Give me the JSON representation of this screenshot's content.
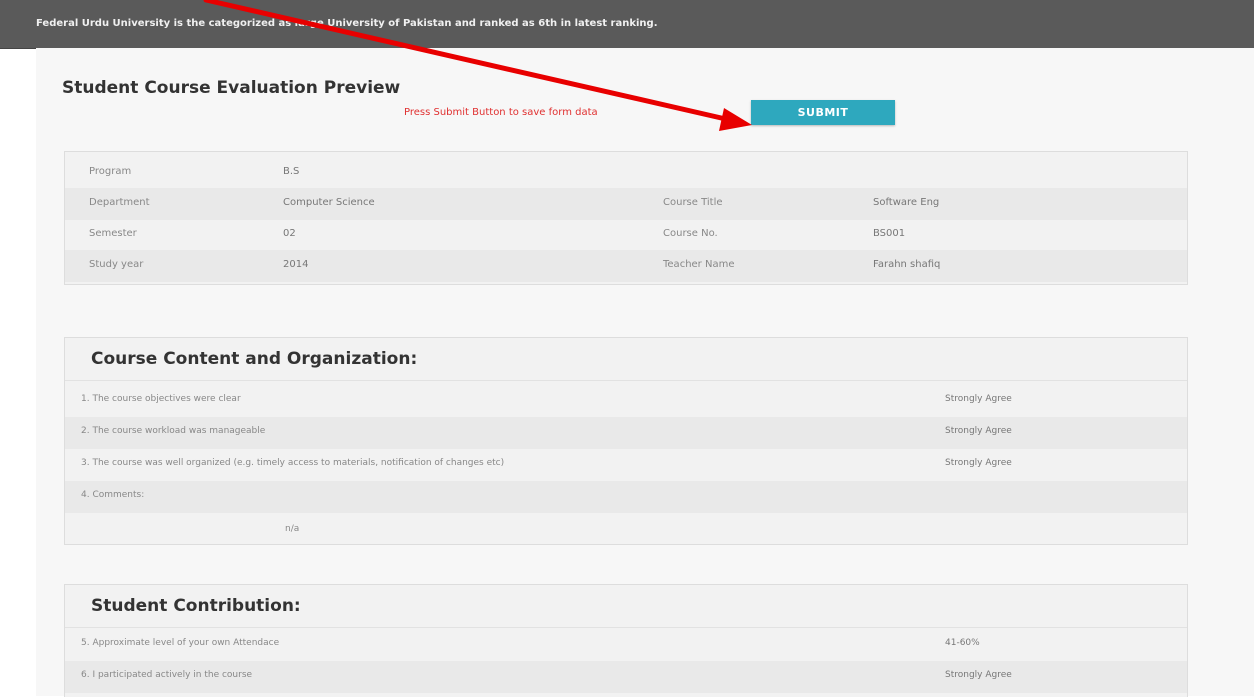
{
  "banner": {
    "text": "Federal Urdu University is the categorized as large University of Pakistan and ranked as 6th in latest ranking."
  },
  "form": {
    "title": "Student Course Evaluation Preview",
    "hint": "Press Submit Button to save form data",
    "submit_label": "SUBMIT",
    "annotation_color": "#e80000"
  },
  "info": {
    "program_label": "Program",
    "program_value": "B.S",
    "department_label": "Department",
    "department_value": "Computer Science",
    "course_title_label": "Course Title",
    "course_title_value": "Software Eng",
    "semester_label": "Semester",
    "semester_value": "02",
    "course_no_label": "Course No.",
    "course_no_value": "BS001",
    "study_year_label": "Study year",
    "study_year_value": "2014",
    "teacher_label": "Teacher Name",
    "teacher_value": "Farahn shafiq"
  },
  "course_content": {
    "heading": "Course Content and Organization:",
    "items": [
      {
        "question": "1. The course objectives were clear",
        "answer": "Strongly Agree"
      },
      {
        "question": "2. The course workload was manageable",
        "answer": "Strongly Agree"
      },
      {
        "question": "3. The course was well organized (e.g. timely access to materials, notification of changes etc)",
        "answer": "Strongly Agree"
      }
    ],
    "comments_label": "4. Comments:",
    "comments_value": "n/a"
  },
  "student_contribution": {
    "heading": "Student Contribution:",
    "items": [
      {
        "question": "5. Approximate level of your own Attendace",
        "answer": "41-60%"
      },
      {
        "question": "6. I participated actively in the course",
        "answer": "Strongly Agree"
      }
    ]
  }
}
